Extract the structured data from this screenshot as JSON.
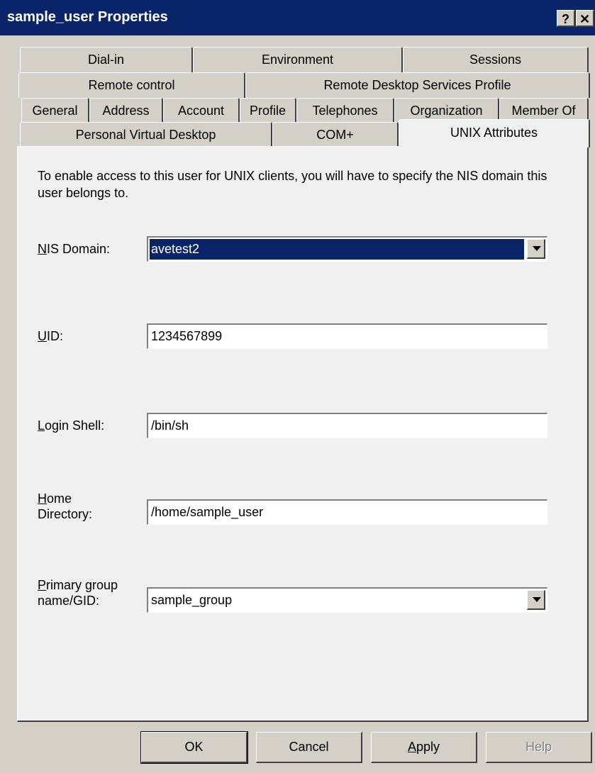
{
  "window": {
    "title": "sample_user Properties",
    "help_glyph": "?",
    "close_glyph": "✕"
  },
  "tabs": {
    "row1": [
      "Dial-in",
      "Environment",
      "Sessions"
    ],
    "row2": [
      "Remote control",
      "Remote Desktop Services Profile"
    ],
    "row3": [
      "General",
      "Address",
      "Account",
      "Profile",
      "Telephones",
      "Organization",
      "Member Of"
    ],
    "row4": [
      "Personal Virtual Desktop",
      "COM+",
      "UNIX Attributes"
    ],
    "active": "UNIX Attributes"
  },
  "form": {
    "intro": "To enable access to this user for UNIX clients, you will have to specify the NIS domain this user belongs to.",
    "nis_domain": {
      "label_pre": "",
      "label_acc": "N",
      "label_post": "IS Domain:",
      "value": "avetest2"
    },
    "uid": {
      "label_pre": "",
      "label_acc": "U",
      "label_post": "ID:",
      "value": "1234567899"
    },
    "login_shell": {
      "label_pre": "",
      "label_acc": "L",
      "label_post": "ogin Shell:",
      "value": "/bin/sh"
    },
    "home_directory": {
      "label_acc": "H",
      "label_line1_post": "ome",
      "label_line2": "Directory:",
      "value": "/home/sample_user"
    },
    "primary_group": {
      "label_acc": "P",
      "label_line1_post": "rimary group",
      "label_line2": "name/GID:",
      "value": "sample_group"
    }
  },
  "buttons": {
    "ok": "OK",
    "cancel": "Cancel",
    "apply_acc": "A",
    "apply_post": "pply",
    "help": "Help",
    "help_disabled": true
  },
  "colors": {
    "titlebar": "#0a246a",
    "dialog": "#d4d0c8",
    "panel": "#f0f0f0"
  }
}
